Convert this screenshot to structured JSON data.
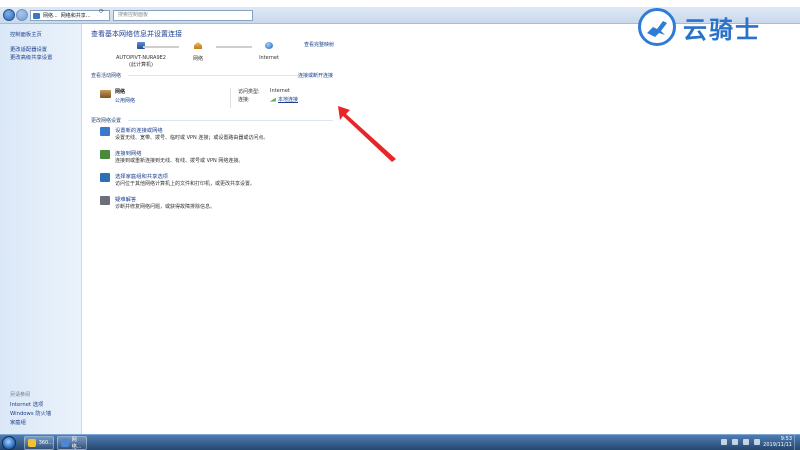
{
  "addressbar": {
    "crumb_1": "网络...",
    "crumb_2": "网络和共享...",
    "search_placeholder": "搜索控制面板"
  },
  "sidebar": {
    "home_link": "控制面板主页",
    "links": [
      "更改适配器设置",
      "更改高级共享设置"
    ],
    "see_also_label": "另请参阅",
    "see_also": [
      "Internet 选项",
      "Windows 防火墙",
      "家庭组"
    ]
  },
  "main": {
    "title": "查看基本网络信息并设置连接",
    "full_map_link": "查看完整映射",
    "map": {
      "computer_name": "AUTOPIVT-NURA9E2",
      "computer_sub": "(此计算机)",
      "network": "网络",
      "internet": "Internet"
    },
    "active_header": "查看活动网络",
    "connect_link": "连接或断开连接",
    "active": {
      "name": "网络",
      "type": "公用网络",
      "access_label": "访问类型:",
      "access_value": "Internet",
      "conn_label": "连接:",
      "conn_value": "本地连接"
    },
    "change_header": "更改网络设置",
    "tasks": [
      {
        "title": "设置新的连接或网络",
        "desc": "设置无线、宽带、拨号、临时或 VPN 连接；或设置路由器或访问点。",
        "icon": "new-connection-icon",
        "color": "#3a79c8"
      },
      {
        "title": "连接到网络",
        "desc": "连接到或重新连接到无线、有线、拨号或 VPN 网络连接。",
        "icon": "connect-network-icon",
        "color": "#4b8a3b"
      },
      {
        "title": "选择家庭组和共享选项",
        "desc": "访问位于其他网络计算机上的文件和打印机，或更改共享设置。",
        "icon": "homegroup-icon",
        "color": "#2f6fb5"
      },
      {
        "title": "疑难解答",
        "desc": "诊断并修复网络问题，或获得故障排除信息。",
        "icon": "troubleshoot-icon",
        "color": "#6a6f7a"
      }
    ]
  },
  "watermark": {
    "text": "云骑士"
  },
  "taskbar": {
    "btn1_label": "360...",
    "btn2_label": "网络...",
    "time": "9:53",
    "date": "2019/11/11"
  },
  "colors": {
    "link": "#1a3e8c",
    "title": "#1e3f8f",
    "arrow": "#e8262a",
    "watermark": "#2a72c9"
  }
}
